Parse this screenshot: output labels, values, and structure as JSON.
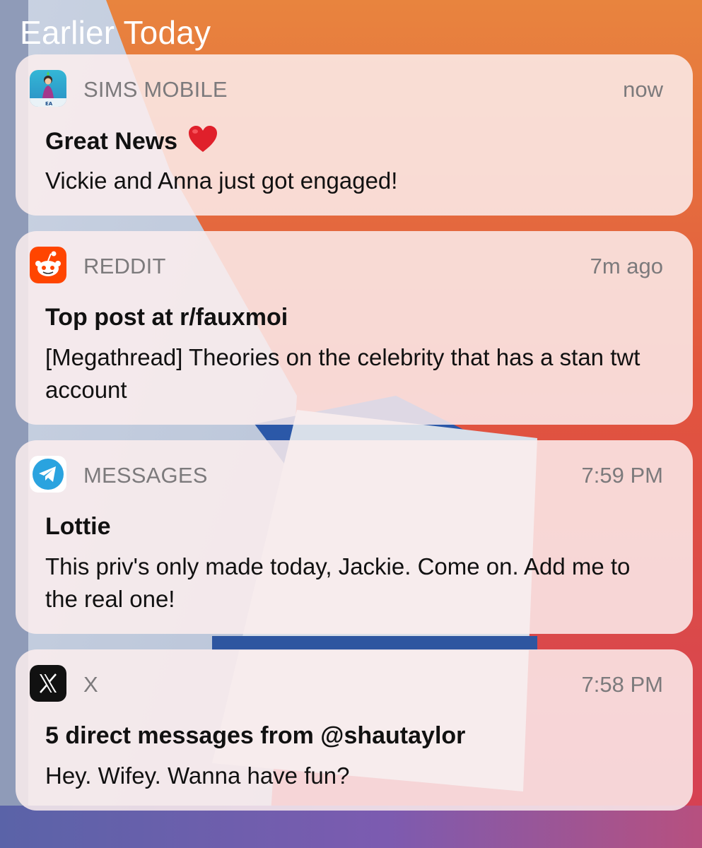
{
  "section": {
    "title": "Earlier Today"
  },
  "notifications": [
    {
      "app": "SIMS MOBILE",
      "time": "now",
      "title": "Great News",
      "title_emoji": "heart",
      "body": "Vickie and Anna just got engaged!",
      "icon": "sims-mobile-icon"
    },
    {
      "app": "REDDIT",
      "time": "7m ago",
      "title": "Top post at r/fauxmoi",
      "body": "[Megathread] Theories on the celebrity that has a stan twt account",
      "icon": "reddit-icon"
    },
    {
      "app": "MESSAGES",
      "time": "7:59 PM",
      "title": "Lottie",
      "body": "This priv's only made today, Jackie. Come on. Add me to the real one!",
      "icon": "telegram-icon"
    },
    {
      "app": "X",
      "time": "7:58 PM",
      "title": "5 direct messages from @shautaylor",
      "body": "Hey. Wifey. Wanna have fun?",
      "icon": "x-icon"
    }
  ],
  "colors": {
    "card_background": "#fceeee",
    "secondary_text": "#7c7a7c",
    "primary_text": "#111111",
    "reddit_orange": "#ff4500",
    "telegram_blue": "#2aa3df",
    "wallpaper_orange": "#e8743a",
    "wallpaper_red": "#d9424a",
    "wallpaper_blue": "#2b58a8"
  }
}
